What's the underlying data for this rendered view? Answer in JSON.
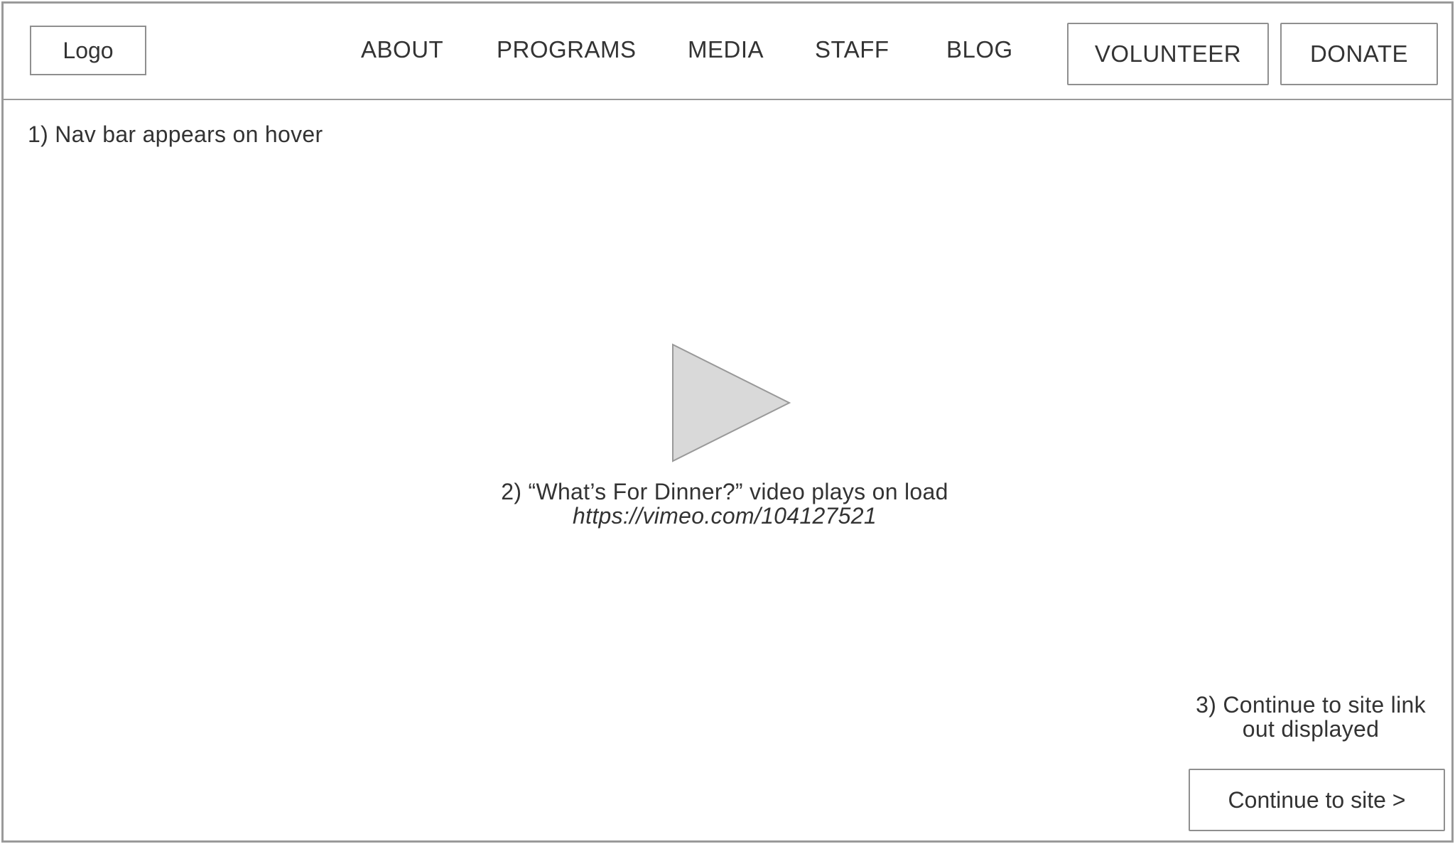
{
  "header": {
    "logo_label": "Logo",
    "nav": [
      {
        "label": "ABOUT"
      },
      {
        "label": "PROGRAMS"
      },
      {
        "label": "MEDIA"
      },
      {
        "label": "STAFF"
      },
      {
        "label": "BLOG"
      }
    ],
    "volunteer_label": "VOLUNTEER",
    "donate_label": "DONATE"
  },
  "notes": {
    "nav_note": "1) Nav bar appears on hover",
    "video_note": "2) “What’s For Dinner?” video plays on load",
    "video_url": "https://vimeo.com/104127521",
    "continue_note_line1": "3) Continue to site link",
    "continue_note_line2": "out displayed"
  },
  "video": {
    "icon": "play-icon"
  },
  "continue_button_label": "Continue to site >",
  "colors": {
    "border": "#9a9a9a",
    "text": "#333333",
    "play_fill": "#d9d9d9",
    "play_stroke": "#999999",
    "background": "#ffffff"
  }
}
